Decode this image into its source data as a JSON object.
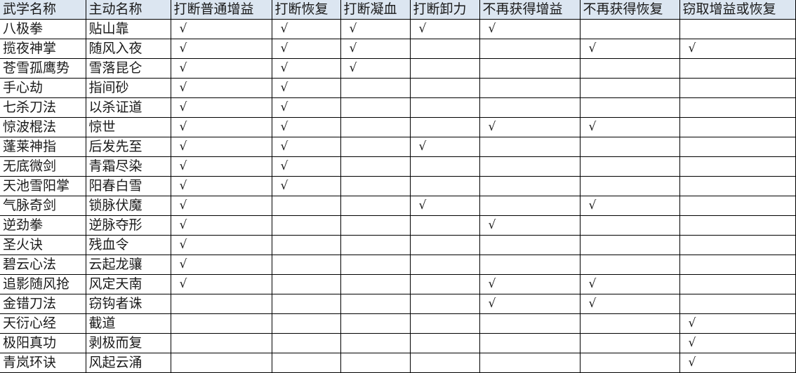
{
  "table": {
    "header_color": "#dce6f1",
    "check_symbol": "√",
    "columns": [
      "武学名称",
      "主动名称",
      "打断普通增益",
      "打断恢复",
      "打断凝血",
      "打断卸力",
      "不再获得增益",
      "不再获得恢复",
      "窃取增益或恢复"
    ],
    "rows": [
      {
        "name": "八极拳",
        "skill": "贴山靠",
        "flags": [
          1,
          1,
          1,
          1,
          1,
          0,
          0
        ]
      },
      {
        "name": "揽夜神掌",
        "skill": "随风入夜",
        "flags": [
          1,
          1,
          1,
          0,
          0,
          1,
          1
        ]
      },
      {
        "name": "苍雪孤鹰势",
        "skill": "雪落昆仑",
        "flags": [
          1,
          1,
          1,
          0,
          0,
          0,
          0
        ]
      },
      {
        "name": "手心劫",
        "skill": "指间砂",
        "flags": [
          1,
          1,
          0,
          0,
          0,
          0,
          0
        ]
      },
      {
        "name": "七杀刀法",
        "skill": "以杀证道",
        "flags": [
          1,
          1,
          0,
          0,
          0,
          0,
          0
        ]
      },
      {
        "name": "惊波棍法",
        "skill": "惊世",
        "flags": [
          1,
          1,
          0,
          0,
          1,
          1,
          0
        ]
      },
      {
        "name": "蓬莱神指",
        "skill": "后发先至",
        "flags": [
          1,
          1,
          0,
          1,
          0,
          0,
          0
        ]
      },
      {
        "name": "无底微剑",
        "skill": "青霜尽染",
        "flags": [
          1,
          1,
          0,
          0,
          0,
          0,
          0
        ]
      },
      {
        "name": "天池雪阳掌",
        "skill": "阳春白雪",
        "flags": [
          1,
          1,
          0,
          0,
          0,
          0,
          0
        ]
      },
      {
        "name": "气脉奇剑",
        "skill": "锁脉伏魔",
        "flags": [
          1,
          0,
          0,
          1,
          0,
          1,
          0
        ]
      },
      {
        "name": "逆劲拳",
        "skill": "逆脉夺形",
        "flags": [
          1,
          0,
          0,
          0,
          1,
          0,
          0
        ]
      },
      {
        "name": "圣火诀",
        "skill": "残血令",
        "flags": [
          1,
          0,
          0,
          0,
          0,
          0,
          0
        ]
      },
      {
        "name": "碧云心法",
        "skill": "云起龙骧",
        "flags": [
          1,
          0,
          0,
          0,
          0,
          0,
          0
        ]
      },
      {
        "name": "追影随风抢",
        "skill": "风定天南",
        "flags": [
          1,
          0,
          0,
          0,
          1,
          1,
          0
        ]
      },
      {
        "name": "金错刀法",
        "skill": "窃钩者诛",
        "flags": [
          0,
          0,
          0,
          0,
          1,
          1,
          0
        ]
      },
      {
        "name": "天衍心经",
        "skill": "截道",
        "flags": [
          0,
          0,
          0,
          0,
          0,
          0,
          1
        ]
      },
      {
        "name": "极阳真功",
        "skill": "剥极而复",
        "flags": [
          0,
          0,
          0,
          0,
          0,
          0,
          1
        ]
      },
      {
        "name": "青岚环诀",
        "skill": "风起云涌",
        "flags": [
          0,
          0,
          0,
          0,
          0,
          0,
          1
        ]
      }
    ]
  }
}
